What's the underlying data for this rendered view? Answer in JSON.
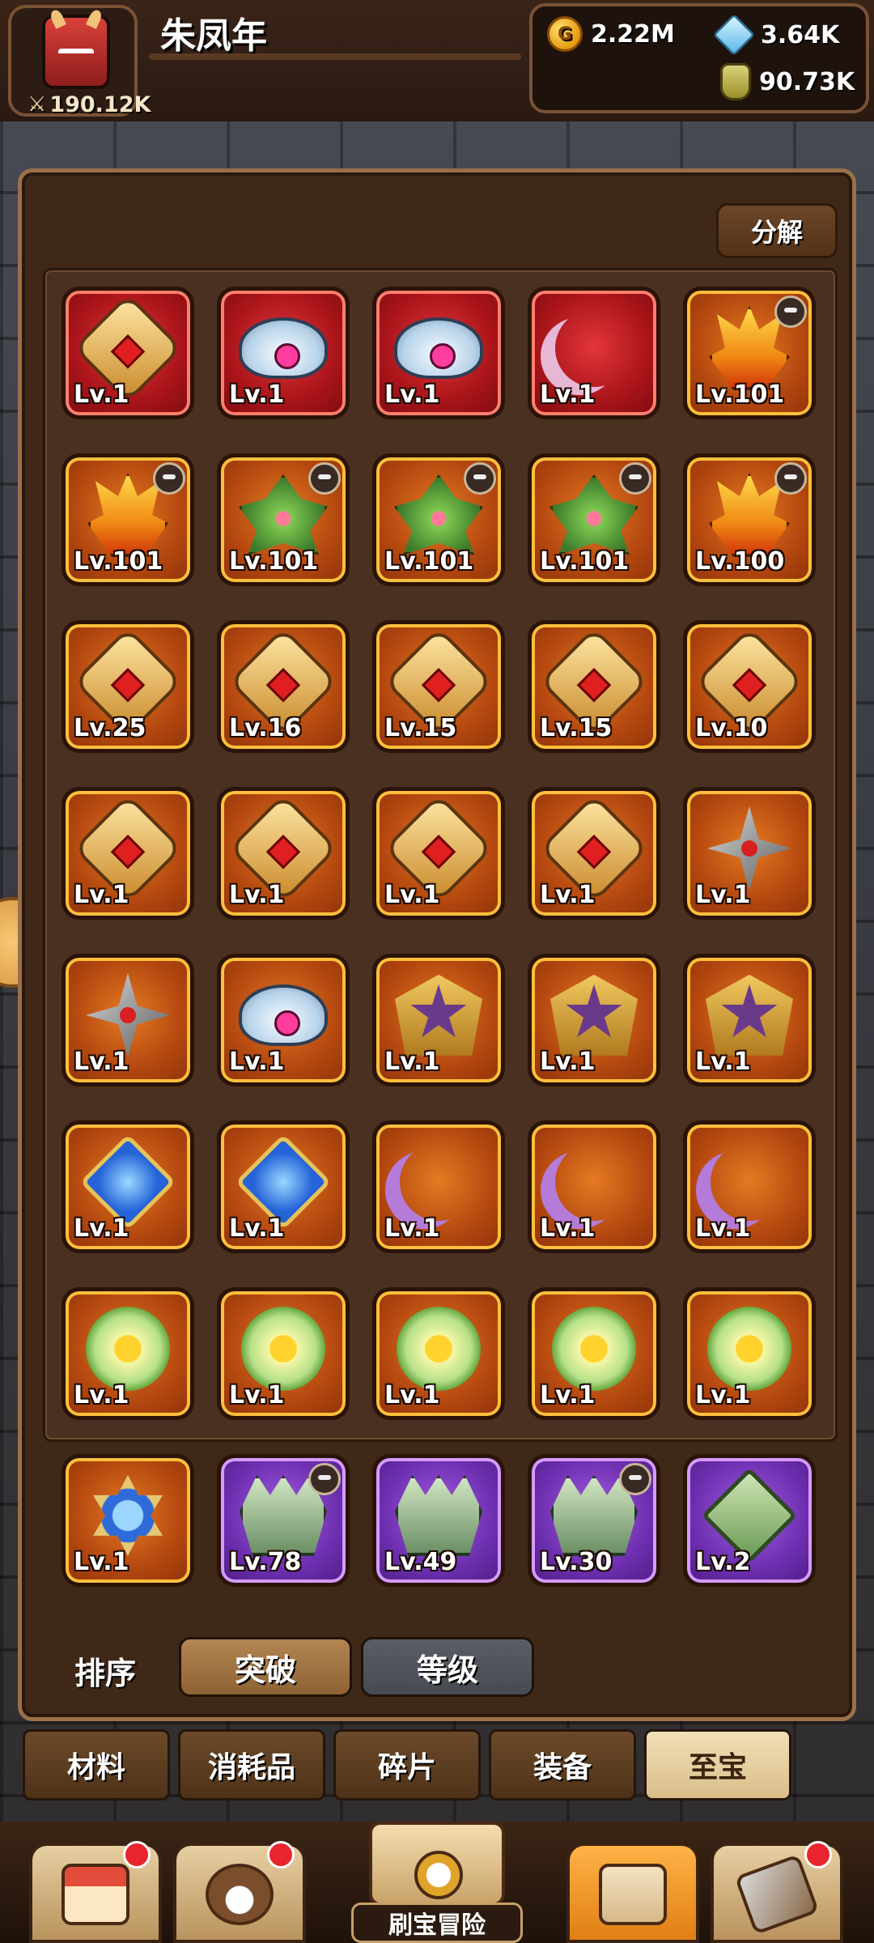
{
  "header": {
    "player_name": "朱凤年",
    "power": "190.12K",
    "gold": "2.22M",
    "crystal": "3.64K",
    "potion": "90.73K"
  },
  "panel": {
    "decompose_label": "分解",
    "items": [
      {
        "level": "Lv.1",
        "frame": "red",
        "art": "shield",
        "owner": false
      },
      {
        "level": "Lv.1",
        "frame": "red",
        "art": "wings",
        "owner": false
      },
      {
        "level": "Lv.1",
        "frame": "red",
        "art": "wings",
        "owner": false
      },
      {
        "level": "Lv.1",
        "frame": "red",
        "art": "moon",
        "owner": false
      },
      {
        "level": "Lv.101",
        "frame": "orange",
        "art": "flame",
        "owner": true
      },
      {
        "level": "Lv.101",
        "frame": "orange",
        "art": "flame",
        "owner": true
      },
      {
        "level": "Lv.101",
        "frame": "orange",
        "art": "leaf",
        "owner": true
      },
      {
        "level": "Lv.101",
        "frame": "orange",
        "art": "leaf",
        "owner": true
      },
      {
        "level": "Lv.101",
        "frame": "orange",
        "art": "leaf",
        "owner": true
      },
      {
        "level": "Lv.100",
        "frame": "orange",
        "art": "flame",
        "owner": true
      },
      {
        "level": "Lv.25",
        "frame": "orange",
        "art": "shield",
        "owner": false
      },
      {
        "level": "Lv.16",
        "frame": "orange",
        "art": "shield",
        "owner": false
      },
      {
        "level": "Lv.15",
        "frame": "orange",
        "art": "shield",
        "owner": false
      },
      {
        "level": "Lv.15",
        "frame": "orange",
        "art": "shield",
        "owner": false
      },
      {
        "level": "Lv.10",
        "frame": "orange",
        "art": "shield",
        "owner": false
      },
      {
        "level": "Lv.1",
        "frame": "orange",
        "art": "shield",
        "owner": false
      },
      {
        "level": "Lv.1",
        "frame": "orange",
        "art": "shield",
        "owner": false
      },
      {
        "level": "Lv.1",
        "frame": "orange",
        "art": "shield",
        "owner": false
      },
      {
        "level": "Lv.1",
        "frame": "orange",
        "art": "shield",
        "owner": false
      },
      {
        "level": "Lv.1",
        "frame": "orange",
        "art": "star",
        "owner": false
      },
      {
        "level": "Lv.1",
        "frame": "orange",
        "art": "star",
        "owner": false
      },
      {
        "level": "Lv.1",
        "frame": "orange",
        "art": "wings",
        "owner": false
      },
      {
        "level": "Lv.1",
        "frame": "orange",
        "art": "pentagram",
        "owner": false
      },
      {
        "level": "Lv.1",
        "frame": "orange",
        "art": "pentagram",
        "owner": false
      },
      {
        "level": "Lv.1",
        "frame": "orange",
        "art": "pentagram",
        "owner": false
      },
      {
        "level": "Lv.1",
        "frame": "orange",
        "art": "sapphire",
        "owner": false
      },
      {
        "level": "Lv.1",
        "frame": "orange",
        "art": "sapphire",
        "owner": false
      },
      {
        "level": "Lv.1",
        "frame": "orange",
        "art": "moon-purple",
        "owner": false
      },
      {
        "level": "Lv.1",
        "frame": "orange",
        "art": "moon-purple",
        "owner": false
      },
      {
        "level": "Lv.1",
        "frame": "orange",
        "art": "moon-purple",
        "owner": false
      },
      {
        "level": "Lv.1",
        "frame": "orange",
        "art": "flower",
        "owner": false
      },
      {
        "level": "Lv.1",
        "frame": "orange",
        "art": "flower",
        "owner": false
      },
      {
        "level": "Lv.1",
        "frame": "orange",
        "art": "flower",
        "owner": false
      },
      {
        "level": "Lv.1",
        "frame": "orange",
        "art": "flower",
        "owner": false
      },
      {
        "level": "Lv.1",
        "frame": "orange",
        "art": "flower",
        "owner": false
      },
      {
        "level": "Lv.1",
        "frame": "orange",
        "art": "hexstar",
        "owner": false
      },
      {
        "level": "Lv.78",
        "frame": "purple",
        "art": "claw",
        "owner": true
      },
      {
        "level": "Lv.49",
        "frame": "purple",
        "art": "claw",
        "owner": false
      },
      {
        "level": "Lv.30",
        "frame": "purple",
        "art": "claw",
        "owner": true
      },
      {
        "level": "Lv.2",
        "frame": "purple",
        "art": "emerald",
        "owner": false
      }
    ]
  },
  "sort": {
    "label": "排序",
    "active_option": "突破",
    "inactive_option": "等级"
  },
  "tabs": [
    "材料",
    "消耗品",
    "碎片",
    "装备",
    "至宝"
  ],
  "selected_tab": "至宝",
  "bottom_nav": {
    "adventure_label": "刷宝冒险"
  },
  "colors": {
    "frame_red": "#a81419",
    "frame_orange": "#b3470f",
    "frame_purple": "#6d2fb0",
    "notification": "#e8242c"
  }
}
